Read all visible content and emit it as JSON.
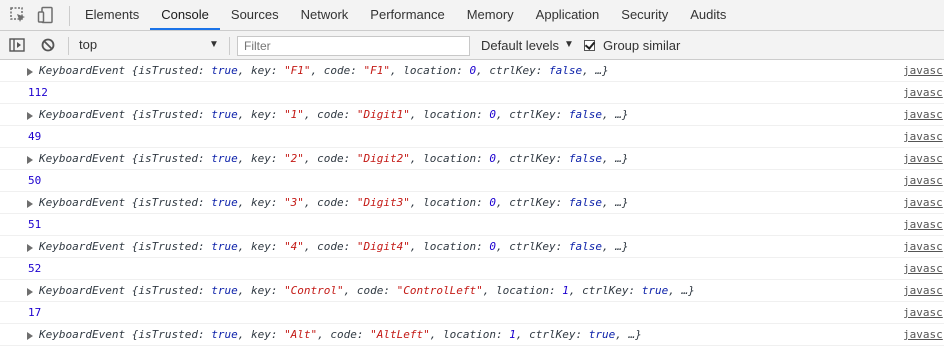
{
  "tabs": [
    {
      "label": "Elements"
    },
    {
      "label": "Console"
    },
    {
      "label": "Sources"
    },
    {
      "label": "Network"
    },
    {
      "label": "Performance"
    },
    {
      "label": "Memory"
    },
    {
      "label": "Application"
    },
    {
      "label": "Security"
    },
    {
      "label": "Audits"
    }
  ],
  "active_tab": "Console",
  "toolbar": {
    "context": "top",
    "filter_placeholder": "Filter",
    "levels": "Default levels",
    "group_similar": "Group similar",
    "group_similar_checked": true
  },
  "icons": {
    "inspect": "inspect-element-icon",
    "device": "device-toolbar-icon",
    "sidebar": "console-sidebar-icon",
    "clear": "clear-console-icon"
  },
  "colors": {
    "accent": "#1a73e8",
    "keyword": "#0d22aa",
    "string": "#c41a16",
    "number": "#1c00cf"
  },
  "source_link": "javasc",
  "rows": [
    {
      "type": "object",
      "key": "\"F1\"",
      "code": "\"F1\"",
      "location": "0",
      "ctrlKey": "false"
    },
    {
      "type": "number",
      "value": "112"
    },
    {
      "type": "object",
      "key": "\"1\"",
      "code": "\"Digit1\"",
      "location": "0",
      "ctrlKey": "false"
    },
    {
      "type": "number",
      "value": "49"
    },
    {
      "type": "object",
      "key": "\"2\"",
      "code": "\"Digit2\"",
      "location": "0",
      "ctrlKey": "false"
    },
    {
      "type": "number",
      "value": "50"
    },
    {
      "type": "object",
      "key": "\"3\"",
      "code": "\"Digit3\"",
      "location": "0",
      "ctrlKey": "false"
    },
    {
      "type": "number",
      "value": "51"
    },
    {
      "type": "object",
      "key": "\"4\"",
      "code": "\"Digit4\"",
      "location": "0",
      "ctrlKey": "false"
    },
    {
      "type": "number",
      "value": "52"
    },
    {
      "type": "object",
      "key": "\"Control\"",
      "code": "\"ControlLeft\"",
      "location": "1",
      "ctrlKey": "true"
    },
    {
      "type": "number",
      "value": "17"
    },
    {
      "type": "object",
      "key": "\"Alt\"",
      "code": "\"AltLeft\"",
      "location": "1",
      "ctrlKey": "true"
    }
  ],
  "object_text": {
    "class_name": "KeyboardEvent",
    "open": " {",
    "isTrusted_label": "isTrusted: ",
    "isTrusted_value": "true",
    "key_label": ", key: ",
    "code_label": ", code: ",
    "location_label": ", location: ",
    "ctrlKey_label": ", ctrlKey: ",
    "close": ", …}"
  }
}
